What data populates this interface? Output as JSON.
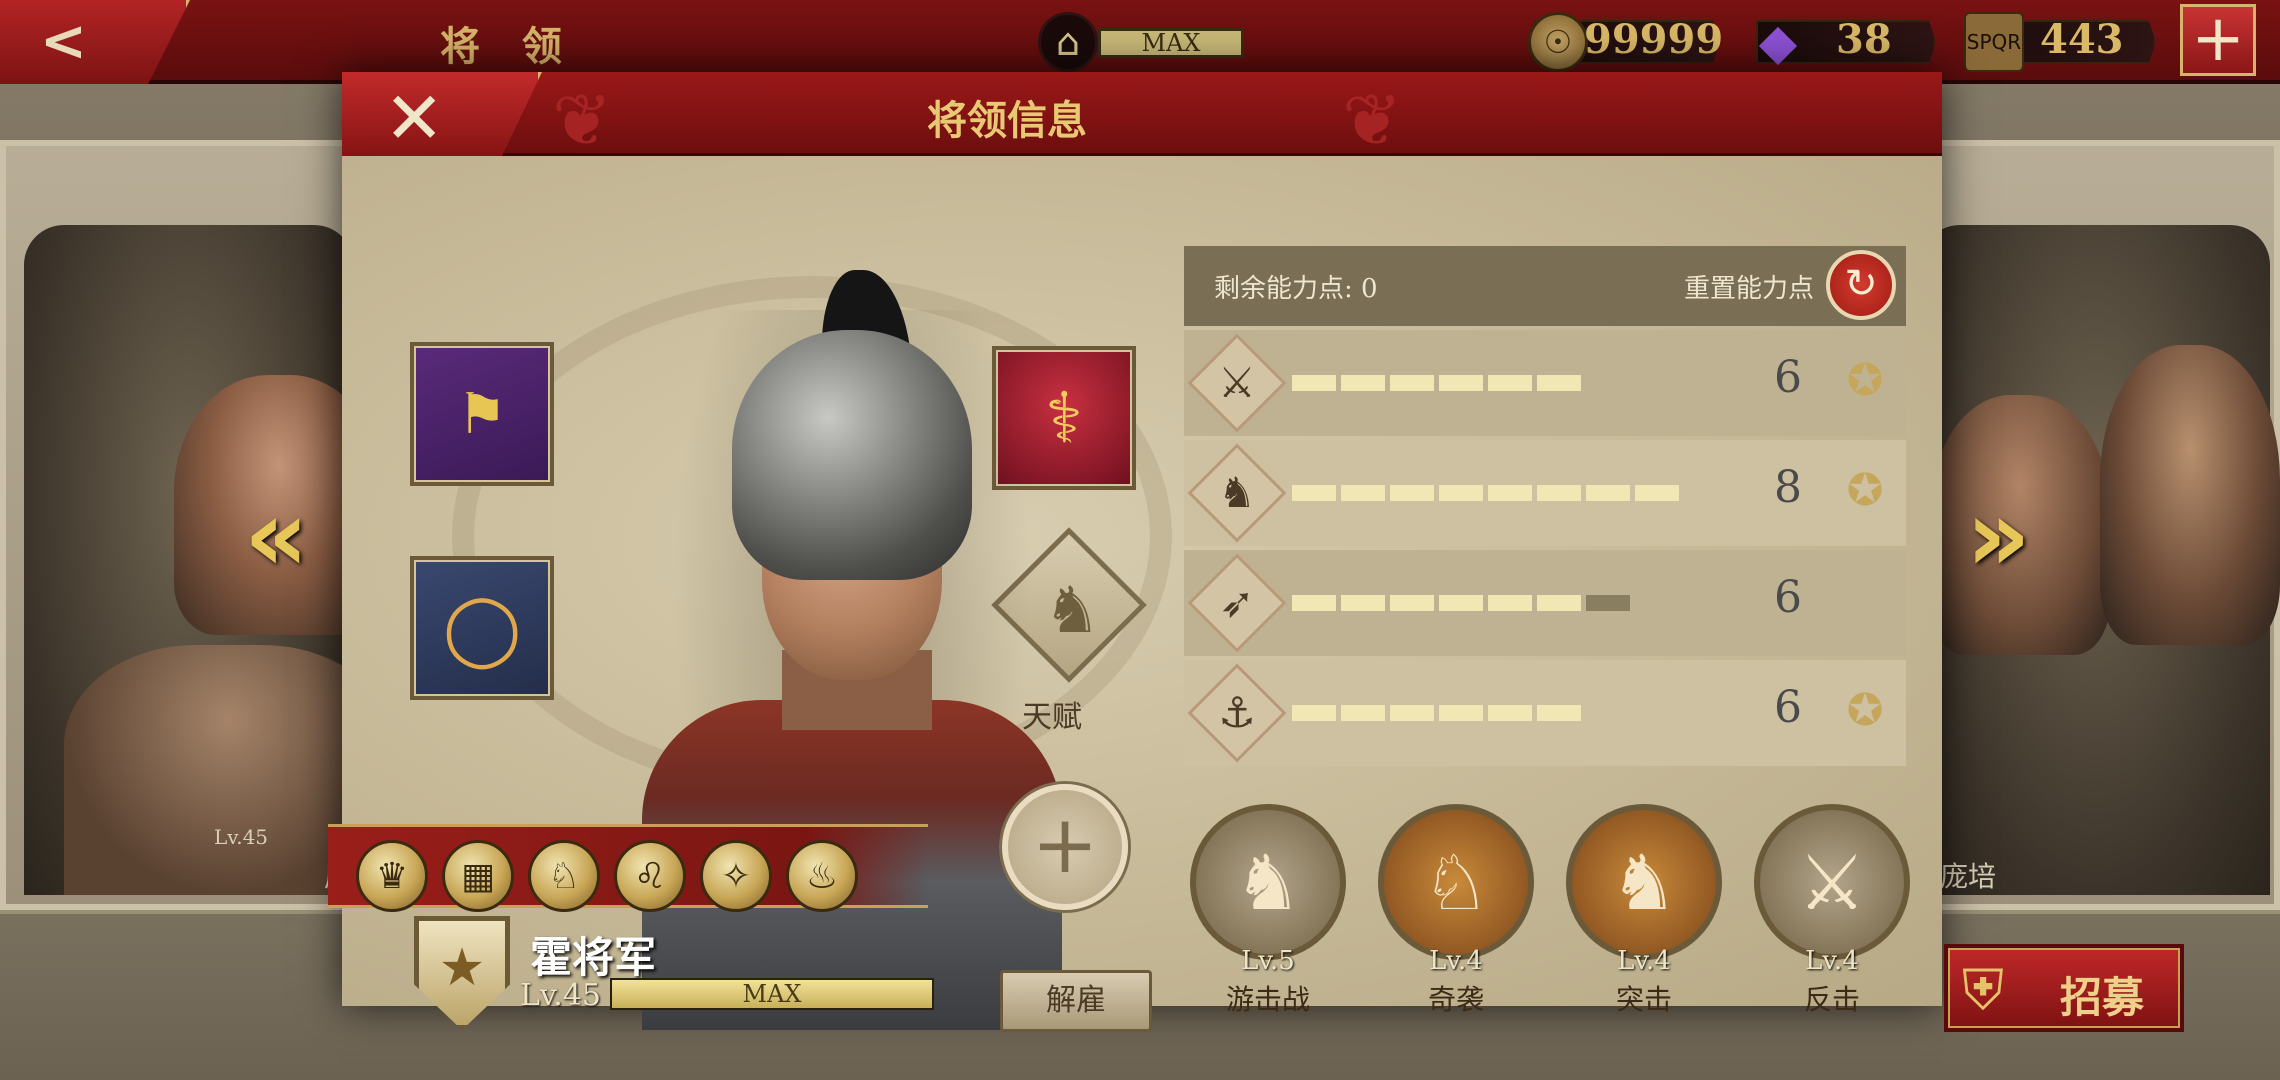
{
  "topbar": {
    "title": "将 领",
    "building_level": "MAX",
    "coins": "99999",
    "gems": "38",
    "tokens": "443"
  },
  "dialog": {
    "title": "将领信息"
  },
  "background": {
    "left_general_name": "屋大",
    "left_general_level": "Lv.45",
    "right_general_name": "庞培"
  },
  "hero": {
    "name": "霍将军",
    "level": "Lv.45",
    "xp_label": "MAX",
    "xp_fraction": 1.0,
    "talent_label": "天赋",
    "dismiss_label": "解雇",
    "equipment": [
      "legion-banner",
      "laurel-wreath",
      "caduceus"
    ],
    "skills": [
      "eagle-skill",
      "formation-skill",
      "cavalry-skill",
      "lion-skill",
      "target-skill",
      "fire-skill"
    ]
  },
  "abilities": {
    "remaining_label": "剩余能力点: 0",
    "reset_label": "重置能力点",
    "stats": [
      {
        "name": "infantry",
        "icon": "sword-icon",
        "value": "6",
        "filled": 6,
        "empty": 0,
        "badge": true
      },
      {
        "name": "cavalry",
        "icon": "horse-icon",
        "value": "8",
        "filled": 8,
        "empty": 0,
        "badge": true
      },
      {
        "name": "archery",
        "icon": "bow-icon",
        "value": "6",
        "filled": 6,
        "empty": 1,
        "badge": false
      },
      {
        "name": "navy",
        "icon": "anchor-icon",
        "value": "6",
        "filled": 6,
        "empty": 0,
        "badge": true
      }
    ]
  },
  "tactics": [
    {
      "level": "Lv.5",
      "name": "游击战",
      "style": "stone"
    },
    {
      "level": "Lv.4",
      "name": "奇袭",
      "style": "bronze"
    },
    {
      "level": "Lv.4",
      "name": "突击",
      "style": "bronze"
    },
    {
      "level": "Lv.4",
      "name": "反击",
      "style": "stone"
    }
  ],
  "recruit_label": "招募",
  "colors": {
    "header_red": "#8a1414",
    "gold": "#d9b867",
    "panel": "#c9bd9f"
  }
}
